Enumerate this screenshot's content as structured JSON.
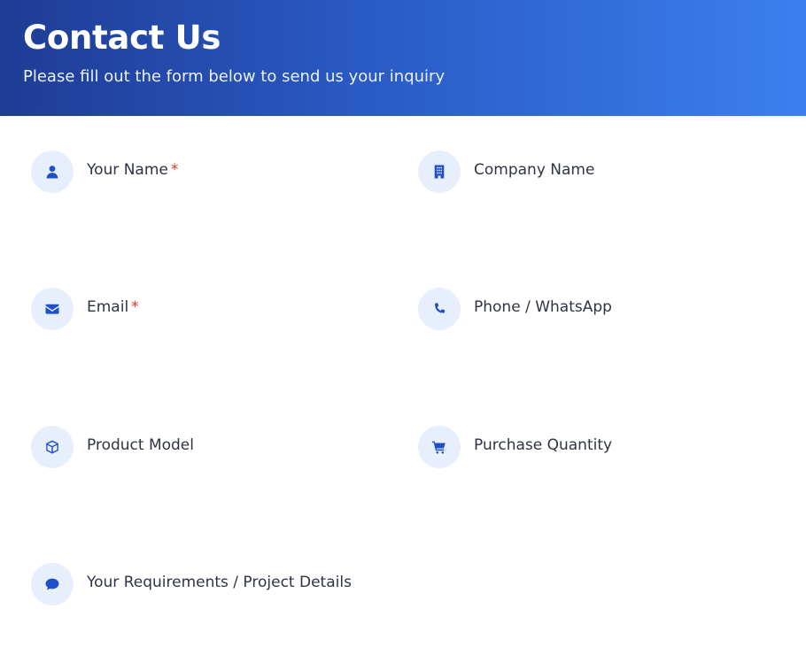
{
  "header": {
    "title": "Contact Us",
    "subtitle": "Please fill out the form below to send us your inquiry"
  },
  "form": {
    "required_marker": "*",
    "fields": {
      "name": {
        "label": "Your Name",
        "required": true,
        "icon": "user-icon"
      },
      "company": {
        "label": "Company Name",
        "required": false,
        "icon": "building-icon"
      },
      "email": {
        "label": "Email",
        "required": true,
        "icon": "envelope-icon"
      },
      "phone": {
        "label": "Phone / WhatsApp",
        "required": false,
        "icon": "phone-icon"
      },
      "model": {
        "label": "Product Model",
        "required": false,
        "icon": "box-icon"
      },
      "quantity": {
        "label": "Purchase Quantity",
        "required": false,
        "icon": "cart-icon"
      },
      "requirements": {
        "label": "Your Requirements / Project Details",
        "required": false,
        "icon": "comment-icon"
      }
    }
  },
  "colors": {
    "header_gradient_start": "#1e3c94",
    "header_gradient_end": "#3a80ee",
    "icon_color": "#1f4fc9",
    "icon_bg": "#e8effc",
    "required": "#e0332c",
    "label_text": "#2f3442"
  }
}
